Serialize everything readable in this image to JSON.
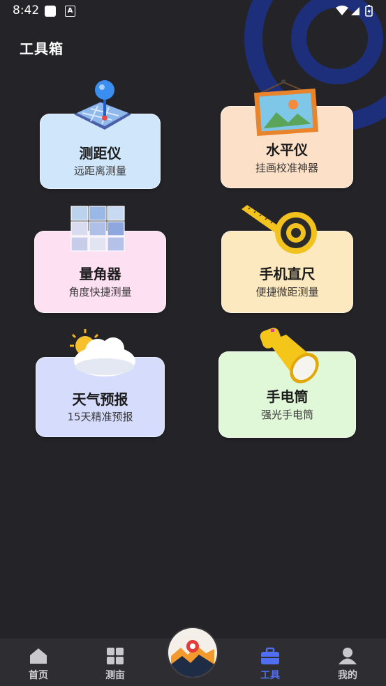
{
  "status_bar": {
    "time": "8:42"
  },
  "header": {
    "title": "工具箱"
  },
  "tools": [
    {
      "name": "测距仪",
      "desc": "远距离测量",
      "bg": "#cfe6fb"
    },
    {
      "name": "水平仪",
      "desc": "挂画校准神器",
      "bg": "#fce0c8"
    },
    {
      "name": "量角器",
      "desc": "角度快捷测量",
      "bg": "#fde0f2"
    },
    {
      "name": "手机直尺",
      "desc": "便捷微距测量",
      "bg": "#fde9bf"
    },
    {
      "name": "天气预报",
      "desc": "15天精准预报",
      "bg": "#d6dcfc"
    },
    {
      "name": "手电筒",
      "desc": "强光手电筒",
      "bg": "#e1f8d8"
    }
  ],
  "tabbar": {
    "items": [
      {
        "label": "首页",
        "icon": "home-icon"
      },
      {
        "label": "测亩",
        "icon": "grid-icon"
      },
      {
        "label": "工具",
        "icon": "toolbox-icon",
        "active": true
      },
      {
        "label": "我的",
        "icon": "user-icon"
      }
    ],
    "center_icon": "map-camera-icon"
  },
  "colors": {
    "accent": "#4f6ff0",
    "background": "#242327"
  }
}
